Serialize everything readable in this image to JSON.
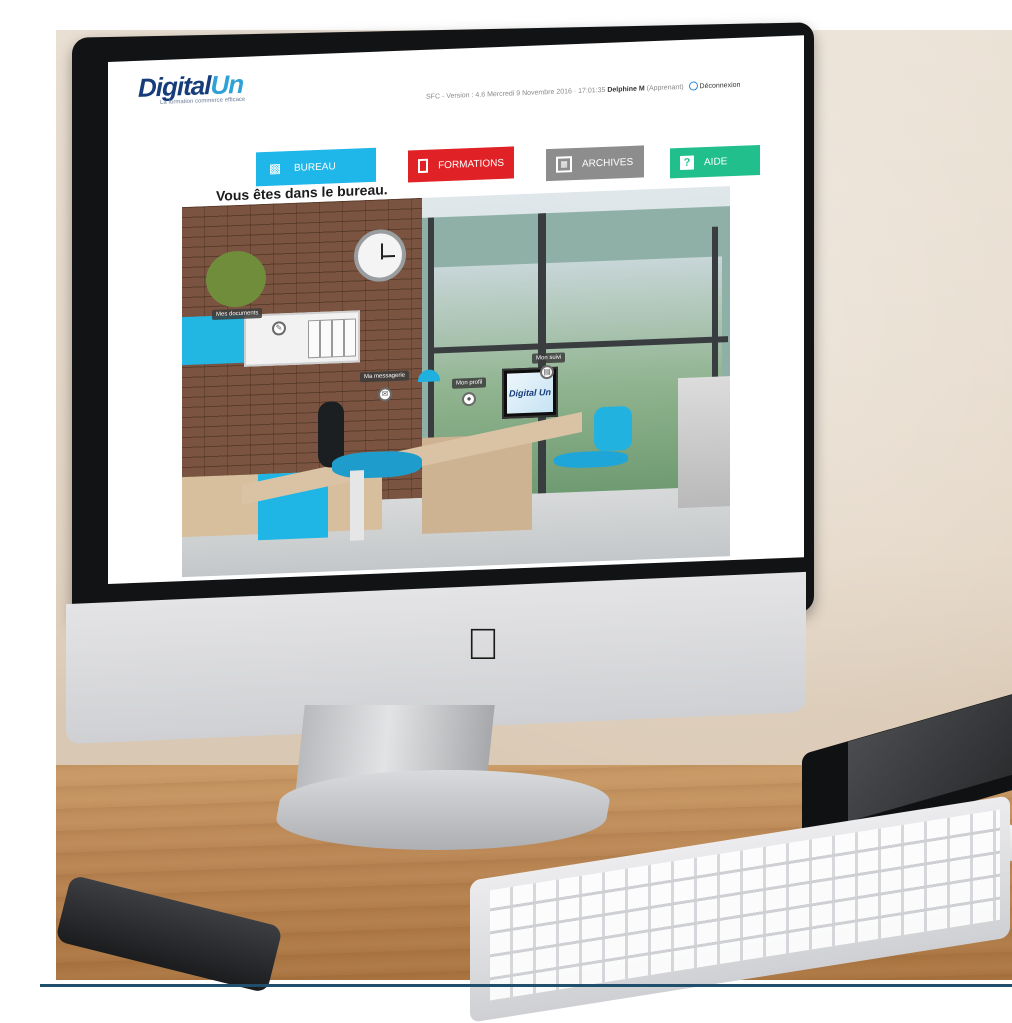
{
  "header": {
    "logo_text_main": "Digital",
    "logo_text_accent": "Un",
    "logo_tagline": "La formation commerce efficace",
    "session_info": "SFC - Version : 4.6 Mercredi 9 Novembre 2016 · 17:01:35",
    "user_name": "Delphine M",
    "user_role": "(Apprenant)",
    "logout_label": "Déconnexion"
  },
  "nav": {
    "bureau_label": "BUREAU",
    "formations_label": "FORMATIONS",
    "archives_label": "ARCHIVES",
    "aide_label": "AIDE",
    "aide_icon_text": "?"
  },
  "status": {
    "message": "Vous êtes dans le bureau."
  },
  "office": {
    "hotspot_documents": "Mes documents",
    "hotspot_messagerie": "Ma messagerie",
    "hotspot_profil": "Mon profil",
    "hotspot_suivi": "Mon suivi",
    "monitor_logo": "Digital Un"
  },
  "colors": {
    "bureau": "#1fb6ea",
    "formations": "#e02226",
    "archives": "#8d8d8d",
    "aide": "#20bf8b",
    "logo_blue": "#163c7a",
    "logo_accent": "#2ea2d8"
  },
  "icons": {
    "bureau": "desk-icon",
    "formations": "monitor-icon",
    "archives": "archive-grid-icon",
    "aide": "question-icon",
    "logout": "power-icon"
  }
}
